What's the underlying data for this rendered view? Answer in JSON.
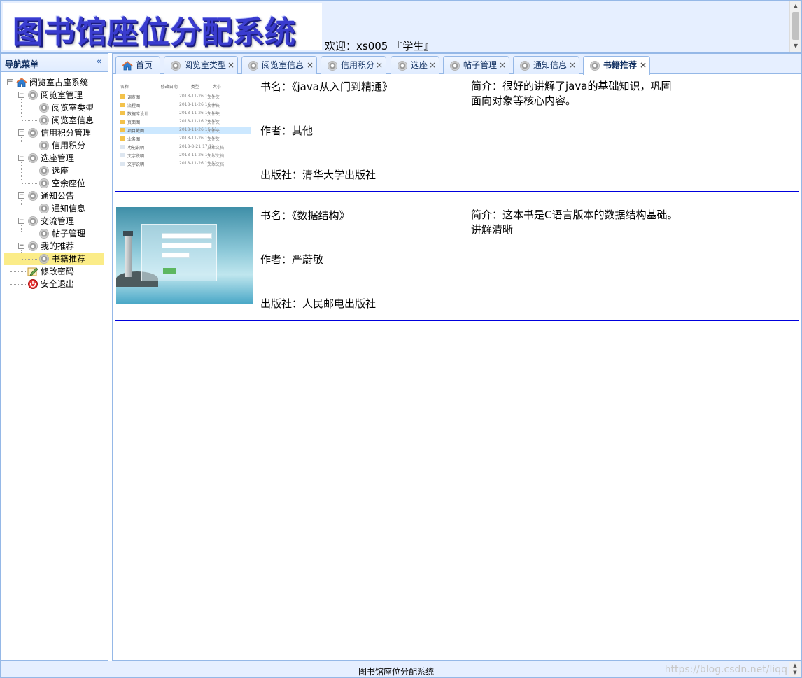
{
  "header": {
    "logo_text": "图书馆座位分配系统",
    "welcome_prefix": "欢迎：xs005",
    "welcome_role": "『学生』"
  },
  "sidebar": {
    "title": "导航菜单",
    "collapse_icon": "double-chevron-left-icon",
    "tree": [
      {
        "label": "阅览室占座系统",
        "icon": "home-icon",
        "expanded": true
      },
      {
        "label": "阅览室管理",
        "icon": "gear-icon",
        "expanded": true
      },
      {
        "label": "阅览室类型",
        "icon": "gear-icon"
      },
      {
        "label": "阅览室信息",
        "icon": "gear-icon"
      },
      {
        "label": "信用积分管理",
        "icon": "gear-icon",
        "expanded": true
      },
      {
        "label": "信用积分",
        "icon": "gear-icon"
      },
      {
        "label": "选座管理",
        "icon": "gear-icon",
        "expanded": true
      },
      {
        "label": "选座",
        "icon": "gear-icon"
      },
      {
        "label": "空余座位",
        "icon": "gear-icon"
      },
      {
        "label": "通知公告",
        "icon": "gear-icon",
        "expanded": true
      },
      {
        "label": "通知信息",
        "icon": "gear-icon"
      },
      {
        "label": "交流管理",
        "icon": "gear-icon",
        "expanded": true
      },
      {
        "label": "帖子管理",
        "icon": "gear-icon"
      },
      {
        "label": "我的推荐",
        "icon": "gear-icon",
        "expanded": true
      },
      {
        "label": "书籍推荐",
        "icon": "gear-icon",
        "selected": true
      },
      {
        "label": "修改密码",
        "icon": "edit-icon"
      },
      {
        "label": "安全退出",
        "icon": "exit-icon"
      }
    ]
  },
  "tabs": [
    {
      "label": "首页",
      "icon": "home-icon",
      "closable": false
    },
    {
      "label": "阅览室类型",
      "icon": "gear-icon",
      "closable": true
    },
    {
      "label": "阅览室信息",
      "icon": "gear-icon",
      "closable": true
    },
    {
      "label": "信用积分",
      "icon": "gear-icon",
      "closable": true
    },
    {
      "label": "选座",
      "icon": "gear-icon",
      "closable": true
    },
    {
      "label": "帖子管理",
      "icon": "gear-icon",
      "closable": true
    },
    {
      "label": "通知信息",
      "icon": "gear-icon",
      "closable": true
    },
    {
      "label": "书籍推荐",
      "icon": "gear-icon",
      "closable": true,
      "active": true
    }
  ],
  "books": [
    {
      "title_label": "书名：",
      "title": "《java从入门到精通》",
      "author_label": "作者：",
      "author": "其他",
      "publisher_label": "出版社：",
      "publisher": "清华大学出版社",
      "intro_label": "简介：",
      "intro": "很好的讲解了java的基础知识，巩固面向对象等核心内容。",
      "cover": "file-explorer-screenshot"
    },
    {
      "title_label": "书名：",
      "title": "《数据结构》",
      "author_label": "作者：",
      "author": "严蔚敏",
      "publisher_label": "出版社：",
      "publisher": "人民邮电出版社",
      "intro_label": "简介：",
      "intro": "这本书是C语言版本的数据结构基础。讲解清晰",
      "cover": "lighthouse-login-screenshot"
    }
  ],
  "footer": {
    "text": "图书馆座位分配系统",
    "watermark": "https://blog.csdn.net/liqq"
  },
  "colors": {
    "panel_bg": "#e6efff",
    "border": "#95b8e7",
    "selected_bg": "#fbec88",
    "divider": "#0000dd",
    "logo": "#3a3ccf"
  }
}
